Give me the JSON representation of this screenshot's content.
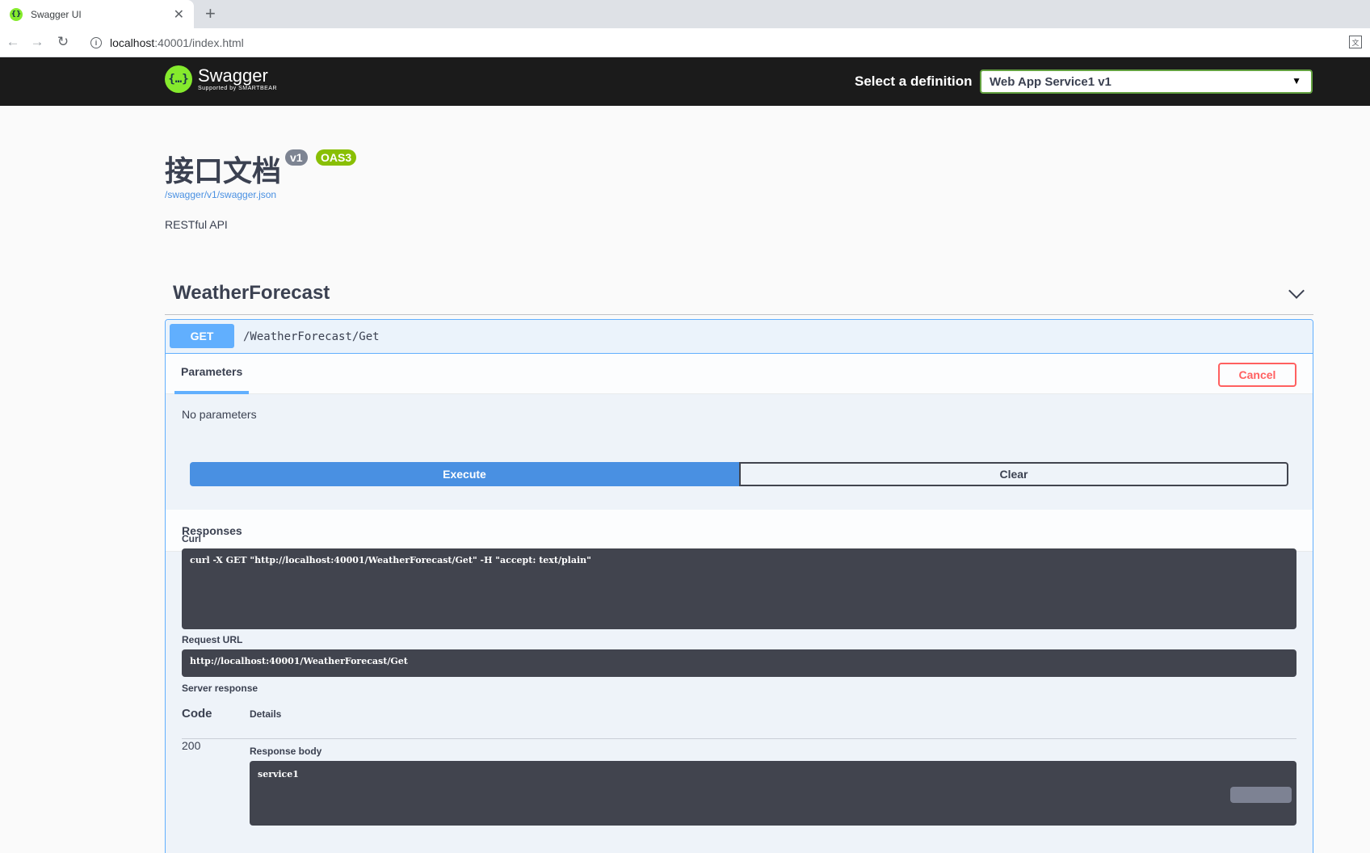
{
  "browser": {
    "tab_title": "Swagger UI",
    "url_host": "localhost",
    "url_rest": ":40001/index.html"
  },
  "topbar": {
    "logo_name": "Swagger",
    "logo_sub": "Supported by SMARTBEAR",
    "select_label": "Select a definition",
    "selected_definition": "Web App Service1 v1"
  },
  "info": {
    "title": "接口文档",
    "version_badge": "v1",
    "oas_badge": "OAS3",
    "spec_link": "/swagger/v1/swagger.json",
    "description": "RESTful API"
  },
  "tag": {
    "name": "WeatherForecast"
  },
  "operation": {
    "method": "GET",
    "path": "/WeatherForecast/Get",
    "parameters_tab": "Parameters",
    "cancel_label": "Cancel",
    "no_params": "No parameters",
    "execute_label": "Execute",
    "clear_label": "Clear",
    "responses_title": "Responses",
    "curl_label": "Curl",
    "curl_command": "curl -X GET \"http://localhost:40001/WeatherForecast/Get\" -H \"accept: text/plain\"",
    "request_url_label": "Request URL",
    "request_url": "http://localhost:40001/WeatherForecast/Get",
    "server_response_label": "Server response",
    "code_col": "Code",
    "details_col": "Details",
    "response_code": "200",
    "response_body_label": "Response body",
    "response_body": "service1"
  },
  "colors": {
    "get_method": "#61affe",
    "execute": "#4990e2",
    "cancel": "#ff6060",
    "swagger_green": "#85ea2d",
    "oas_badge": "#89bf04"
  }
}
